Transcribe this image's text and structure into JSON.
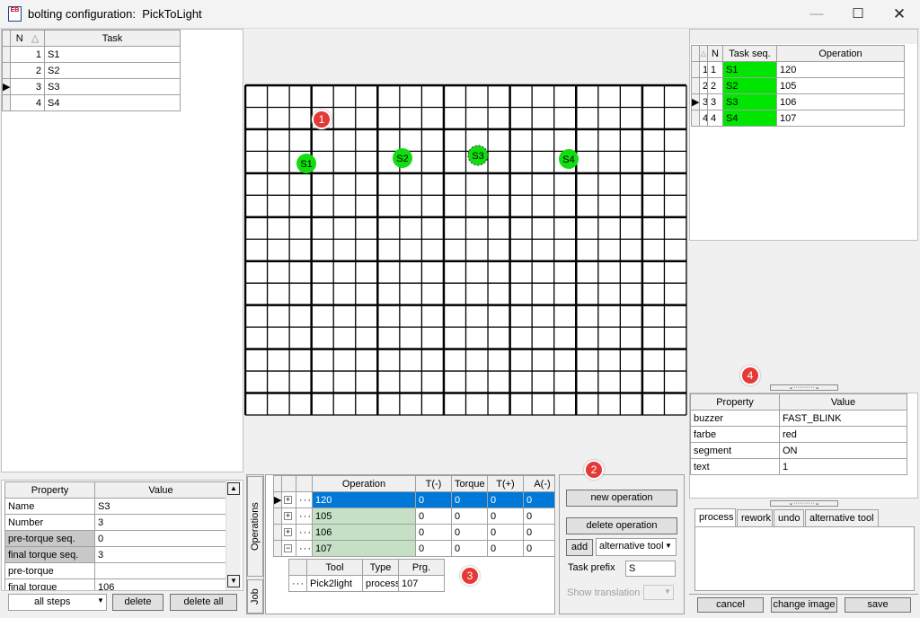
{
  "window": {
    "title": "bolting configuration:  PickToLight",
    "minimize": "—",
    "maximize": "☐",
    "close": "✕",
    "icon_label": "EB"
  },
  "task_table": {
    "headers": {
      "n": "N",
      "sort": "△",
      "task": "Task"
    },
    "rows": [
      {
        "n": "1",
        "task": "S1"
      },
      {
        "n": "2",
        "task": "S2"
      },
      {
        "n": "3",
        "task": "S3",
        "current": true
      },
      {
        "n": "4",
        "task": "S4"
      }
    ]
  },
  "canvas": {
    "bolts": [
      "S1",
      "S2",
      "S3",
      "S4"
    ],
    "grid_color": "#000000",
    "bolt_color": "#11dd11"
  },
  "markers": [
    "1",
    "2",
    "3",
    "4"
  ],
  "properties_left": {
    "headers": {
      "property": "Property",
      "value": "Value"
    },
    "rows": [
      {
        "property": "Name",
        "value": "S3"
      },
      {
        "property": "Number",
        "value": "3"
      },
      {
        "property": "pre-torque seq.",
        "value": "0",
        "grey": true
      },
      {
        "property": "final torque seq.",
        "value": "3",
        "grey": true
      },
      {
        "property": "pre-torque",
        "value": ""
      },
      {
        "property": "final torque",
        "value": "106"
      }
    ]
  },
  "left_bottom": {
    "all_steps": "all steps",
    "delete": "delete",
    "delete_all": "delete all"
  },
  "operations": {
    "tabs": {
      "operations": "Operations",
      "job": "Job"
    },
    "headers": {
      "operation": "Operation",
      "t_minus": "T(-)",
      "torque": "Torque",
      "t_plus": "T(+)",
      "a_minus": "A(-)"
    },
    "rows": [
      {
        "expander": "+",
        "operation": "120",
        "t_minus": "0",
        "torque": "0",
        "t_plus": "0",
        "a_minus": "0",
        "selected": true
      },
      {
        "expander": "+",
        "operation": "105",
        "t_minus": "0",
        "torque": "0",
        "t_plus": "0",
        "a_minus": "0"
      },
      {
        "expander": "+",
        "operation": "106",
        "t_minus": "0",
        "torque": "0",
        "t_plus": "0",
        "a_minus": "0"
      },
      {
        "expander": "−",
        "operation": "107",
        "t_minus": "0",
        "torque": "0",
        "t_plus": "0",
        "a_minus": "0"
      }
    ],
    "sub_headers": {
      "tool": "Tool",
      "type": "Type",
      "prg": "Prg."
    },
    "sub_row": {
      "tool": "Pick2light",
      "type": "process",
      "prg": "107"
    }
  },
  "op_controls": {
    "new_operation": "new operation",
    "delete_operation": "delete operation",
    "add": "add",
    "tool_select": "alternative tool",
    "task_prefix_label": "Task prefix",
    "task_prefix_value": "S",
    "show_translation": "Show translation"
  },
  "task_seq_table": {
    "headers": {
      "sort": "△",
      "n": "N",
      "task_seq": "Task seq.",
      "operation": "Operation"
    },
    "rows": [
      {
        "idx": "1",
        "n": "1",
        "task_seq": "S1",
        "operation": "120"
      },
      {
        "idx": "2",
        "n": "2",
        "task_seq": "S2",
        "operation": "105"
      },
      {
        "idx": "3",
        "n": "3",
        "task_seq": "S3",
        "operation": "106",
        "current": true
      },
      {
        "idx": "4",
        "n": "4",
        "task_seq": "S4",
        "operation": "107"
      }
    ]
  },
  "properties_right": {
    "headers": {
      "property": "Property",
      "value": "Value"
    },
    "rows": [
      {
        "property": "buzzer",
        "value": "FAST_BLINK"
      },
      {
        "property": "farbe",
        "value": "red"
      },
      {
        "property": "segment",
        "value": "ON"
      },
      {
        "property": "text",
        "value": "1"
      }
    ]
  },
  "right_tabs": [
    "process",
    "rework",
    "undo",
    "alternative tool"
  ],
  "right_bottom": {
    "cancel": "cancel",
    "change_image": "change image",
    "save": "save"
  },
  "splitter_glyph": "⌄··········⌄"
}
